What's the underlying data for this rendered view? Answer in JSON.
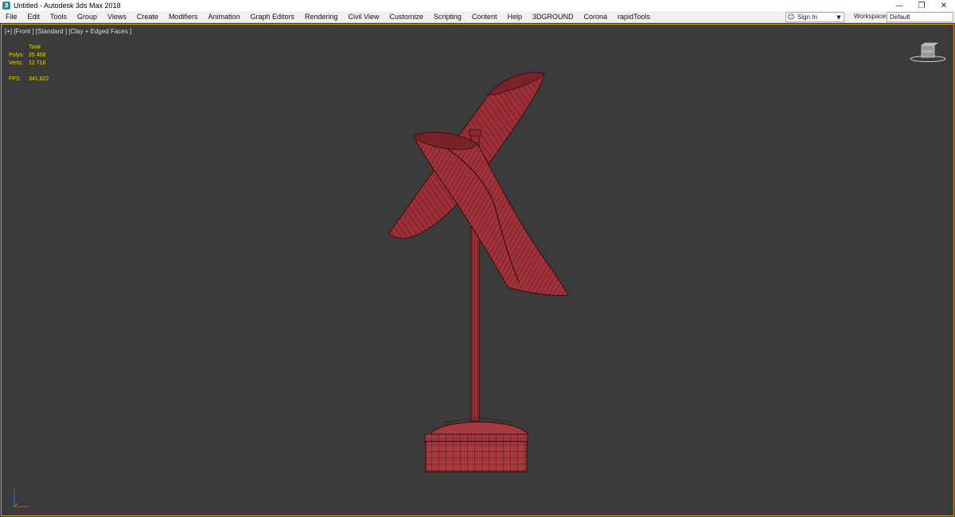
{
  "titlebar": {
    "app_icon": "3ds-max-logo",
    "title": "Untitled - Autodesk 3ds Max 2018",
    "minimize": "—",
    "restore": "❐",
    "close": "✕"
  },
  "menu": {
    "items": [
      {
        "label": "File"
      },
      {
        "label": "Edit"
      },
      {
        "label": "Tools"
      },
      {
        "label": "Group"
      },
      {
        "label": "Views"
      },
      {
        "label": "Create"
      },
      {
        "label": "Modifiers"
      },
      {
        "label": "Animation"
      },
      {
        "label": "Graph Editors"
      },
      {
        "label": "Rendering"
      },
      {
        "label": "Civil View"
      },
      {
        "label": "Customize"
      },
      {
        "label": "Scripting"
      },
      {
        "label": "Content"
      },
      {
        "label": "Help"
      },
      {
        "label": "3DGROUND"
      },
      {
        "label": "Corona"
      },
      {
        "label": "rapidTools"
      }
    ],
    "sign_in": "Sign In",
    "workspaces_label": "Workspaces:",
    "workspaces_value": "Default"
  },
  "viewport": {
    "label": "[+] [Front ] [Standard ] [Clay + Edged Faces ]",
    "stats": {
      "header": "Total",
      "polys_label": "Polys:",
      "polys_value": "25 408",
      "verts_label": "Verts:",
      "verts_value": "12 718",
      "fps_label": "FPS:",
      "fps_value": "341,822"
    },
    "viewcube_icon": "viewcube-icon",
    "tripod_icon": "axis-tripod-icon",
    "colors": {
      "border_active": "#c8a12c",
      "stats_text": "#e6d600",
      "model_fill": "#9a2f35",
      "model_wire": "#4a1014",
      "background": "#3b3b3b"
    }
  }
}
